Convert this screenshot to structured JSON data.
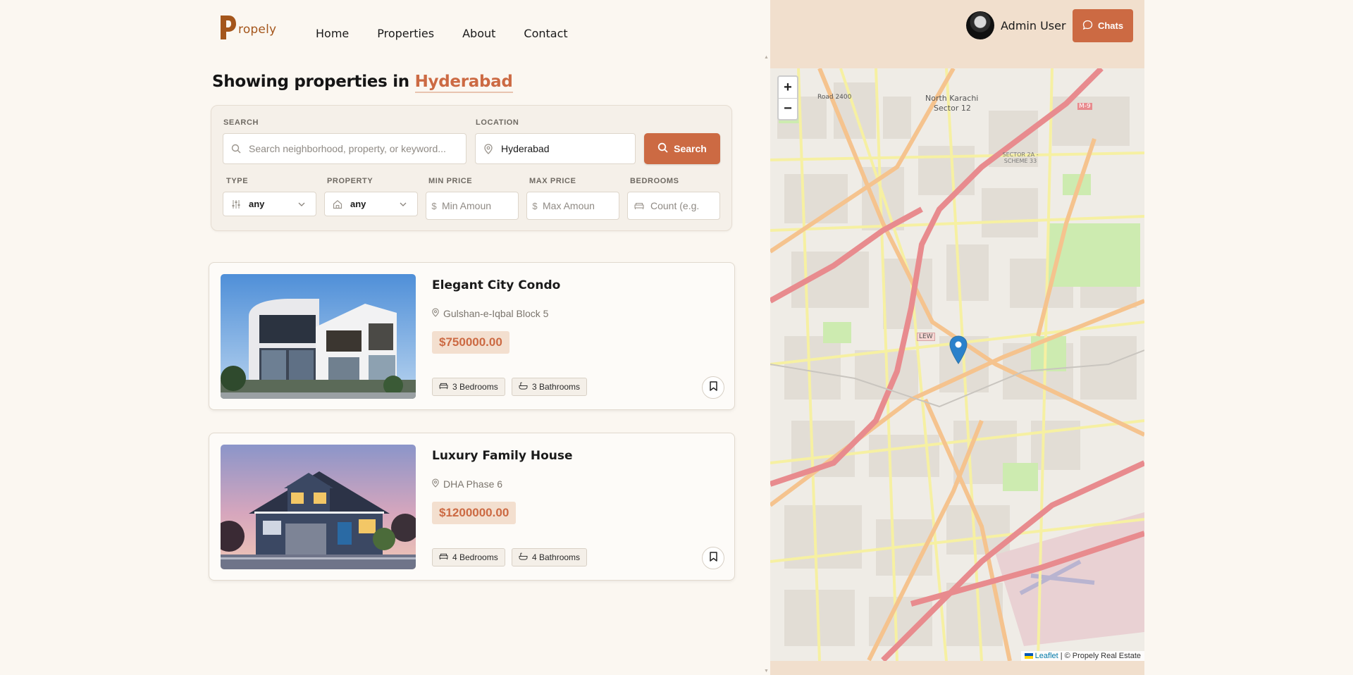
{
  "brand": {
    "first_letter": "P",
    "rest": "ropely"
  },
  "nav": {
    "items": [
      "Home",
      "Properties",
      "About",
      "Contact"
    ]
  },
  "heading": {
    "prefix": "Showing properties in",
    "city": "Hyderabad"
  },
  "search": {
    "search_label": "SEARCH",
    "search_placeholder": "Search neighborhood, property, or keyword...",
    "location_label": "LOCATION",
    "location_value": "Hyderabad",
    "button_label": "Search",
    "type_label": "TYPE",
    "type_value": "any",
    "property_label": "PROPERTY",
    "property_value": "any",
    "min_price_label": "MIN PRICE",
    "min_price_placeholder": "Min Amount",
    "max_price_label": "MAX PRICE",
    "max_price_placeholder": "Max Amount",
    "bedrooms_label": "BEDROOMS",
    "bedrooms_placeholder": "Count (e.g."
  },
  "listings": [
    {
      "title": "Elegant City Condo",
      "location": "Gulshan-e-Iqbal Block 5",
      "price": "$750000.00",
      "bedrooms": "3 Bedrooms",
      "bathrooms": "3 Bathrooms"
    },
    {
      "title": "Luxury Family House",
      "location": "DHA Phase 6",
      "price": "$1200000.00",
      "bedrooms": "4 Bedrooms",
      "bathrooms": "4 Bathrooms"
    }
  ],
  "header_right": {
    "user_name": "Admin User",
    "chats_label": "Chats"
  },
  "map": {
    "zoom_in": "+",
    "zoom_out": "−",
    "attribution_link": "Leaflet",
    "attribution_text": "| © Propely Real Estate",
    "labels": {
      "north_karachi": "North Karachi",
      "sector_12": "Sector 12",
      "road_2400": "Road 2400",
      "sector_2a": "SECTOR 2A - SCHEME 33",
      "m9": "M-9",
      "lew": "LEW"
    }
  },
  "colors": {
    "accent": "#cc6a43",
    "page_bg": "#fbf7f1",
    "right_bg": "#f1dfcd",
    "price_bg": "#f3dfcf"
  }
}
